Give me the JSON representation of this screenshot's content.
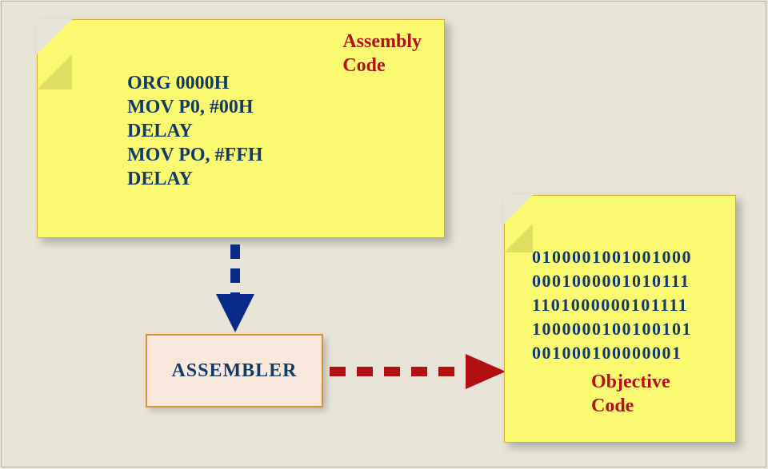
{
  "labels": {
    "assembly_title_l1": "Assembly",
    "assembly_title_l2": "Code",
    "objective_title_l1": "Objective",
    "objective_title_l2": "Code",
    "assembler": "ASSEMBLER"
  },
  "assembly_code": {
    "l1": "ORG 0000H",
    "l2": "MOV P0, #00H",
    "l3": "DELAY",
    "l4": "MOV PO, #FFH",
    "l5": "DELAY"
  },
  "objective_code": {
    "l1": "0100001001001000",
    "l2": "0001000001010111",
    "l3": "1101000000101111",
    "l4": "1000000100100101",
    "l5": "001000100000001"
  },
  "chart_data": {
    "type": "diagram",
    "nodes": [
      {
        "id": "assembly",
        "label": "Assembly Code",
        "content": [
          "ORG 0000H",
          "MOV P0, #00H",
          "DELAY",
          "MOV PO, #FFH",
          "DELAY"
        ]
      },
      {
        "id": "assembler",
        "label": "ASSEMBLER"
      },
      {
        "id": "objective",
        "label": "Objective Code",
        "content": [
          "0100001001001000",
          "0001000001010111",
          "1101000000101111",
          "1000000100100101",
          "001000100000001"
        ]
      }
    ],
    "edges": [
      {
        "from": "assembly",
        "to": "assembler",
        "style": "dashed",
        "color": "#0a2a8a"
      },
      {
        "from": "assembler",
        "to": "objective",
        "style": "dashed",
        "color": "#b31111"
      }
    ]
  }
}
